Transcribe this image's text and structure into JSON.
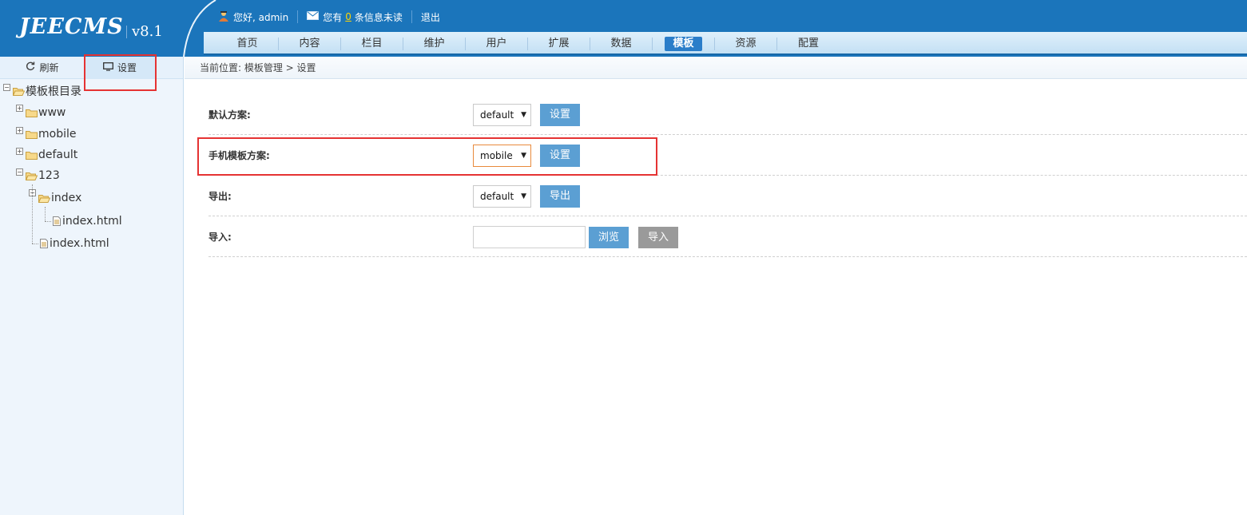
{
  "app": {
    "logo": "JEECMS",
    "version": "v8.1",
    "greeting": "您好, admin",
    "messages_prefix": "您有",
    "messages_count": "0",
    "messages_suffix": "条信息未读",
    "logout": "退出"
  },
  "nav": {
    "items": [
      "首页",
      "内容",
      "栏目",
      "维护",
      "用户",
      "扩展",
      "数据",
      "模板",
      "资源",
      "配置"
    ],
    "active": "模板"
  },
  "left_toolbar": {
    "refresh_label": "刷新",
    "settings_label": "设置"
  },
  "tree": {
    "root": "模板根目录",
    "items": [
      {
        "label": "www",
        "type": "folder",
        "expanded": false
      },
      {
        "label": "mobile",
        "type": "folder",
        "expanded": false
      },
      {
        "label": "default",
        "type": "folder",
        "expanded": false
      },
      {
        "label": "123",
        "type": "folder",
        "expanded": true
      },
      {
        "label": "index",
        "type": "folder",
        "expanded": true
      },
      {
        "label": "index.html",
        "type": "file"
      },
      {
        "label": "index.html",
        "type": "file"
      }
    ]
  },
  "breadcrumb": "当前位置: 模板管理 > 设置",
  "form": {
    "default_scheme": {
      "label": "默认方案:",
      "value": "default",
      "button": "设置"
    },
    "mobile_scheme": {
      "label": "手机模板方案:",
      "value": "mobile",
      "button": "设置"
    },
    "export": {
      "label": "导出:",
      "value": "default",
      "button": "导出"
    },
    "import": {
      "label": "导入:",
      "value": "",
      "browse_button": "浏览",
      "import_button": "导入"
    }
  },
  "colors": {
    "header": "#1b75bb",
    "accent": "#5b9fd3",
    "highlight": "#e53333"
  }
}
